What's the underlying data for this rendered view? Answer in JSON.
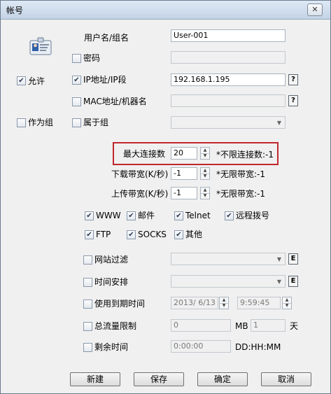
{
  "window": {
    "title": "帐号",
    "close_glyph": "✕"
  },
  "account": {
    "username_label": "用户名/组名",
    "username_value": "User-001",
    "password_label": "密码",
    "password_checked": false,
    "allow_label": "允许",
    "allow_checked": true,
    "ip_label": "IP地址/IP段",
    "ip_checked": true,
    "ip_value": "192.168.1.195",
    "help_glyph": "?",
    "mac_label": "MAC地址/机器名",
    "mac_checked": false,
    "as_group_label": "作为组",
    "as_group_checked": false,
    "belongs_group_label": "属于组",
    "belongs_group_checked": false
  },
  "limits": {
    "max_conn_label": "最大连接数",
    "max_conn_value": "20",
    "max_conn_hint": "*不限连接数:-1",
    "download_label": "下载带宽(K/秒)",
    "download_value": "-1",
    "download_hint": "*无限带宽:-1",
    "upload_label": "上传带宽(K/秒)",
    "upload_value": "-1",
    "upload_hint": "*无限带宽:-1"
  },
  "services": [
    {
      "label": "WWW",
      "checked": true
    },
    {
      "label": "邮件",
      "checked": true
    },
    {
      "label": "Telnet",
      "checked": true
    },
    {
      "label": "远程拨号",
      "checked": true
    },
    {
      "label": "FTP",
      "checked": true
    },
    {
      "label": "SOCKS",
      "checked": true
    },
    {
      "label": "其他",
      "checked": true
    }
  ],
  "options": {
    "web_filter_label": "网站过滤",
    "web_filter_checked": false,
    "schedule_label": "时间安排",
    "schedule_checked": false,
    "edit_glyph": "E",
    "expiry_label": "使用到期时间",
    "expiry_checked": false,
    "expiry_date": "2013/ 6/13",
    "expiry_time": "9:59:45",
    "traffic_label": "总流量限制",
    "traffic_checked": false,
    "traffic_value": "0",
    "traffic_unit": "MB",
    "traffic_days": "1",
    "traffic_days_unit": "天",
    "remaining_label": "剩余时间",
    "remaining_checked": false,
    "remaining_value": "0:00:00",
    "remaining_format": "DD:HH:MM"
  },
  "buttons": {
    "new": "新建",
    "save": "保存",
    "ok": "确定",
    "cancel": "取消"
  }
}
